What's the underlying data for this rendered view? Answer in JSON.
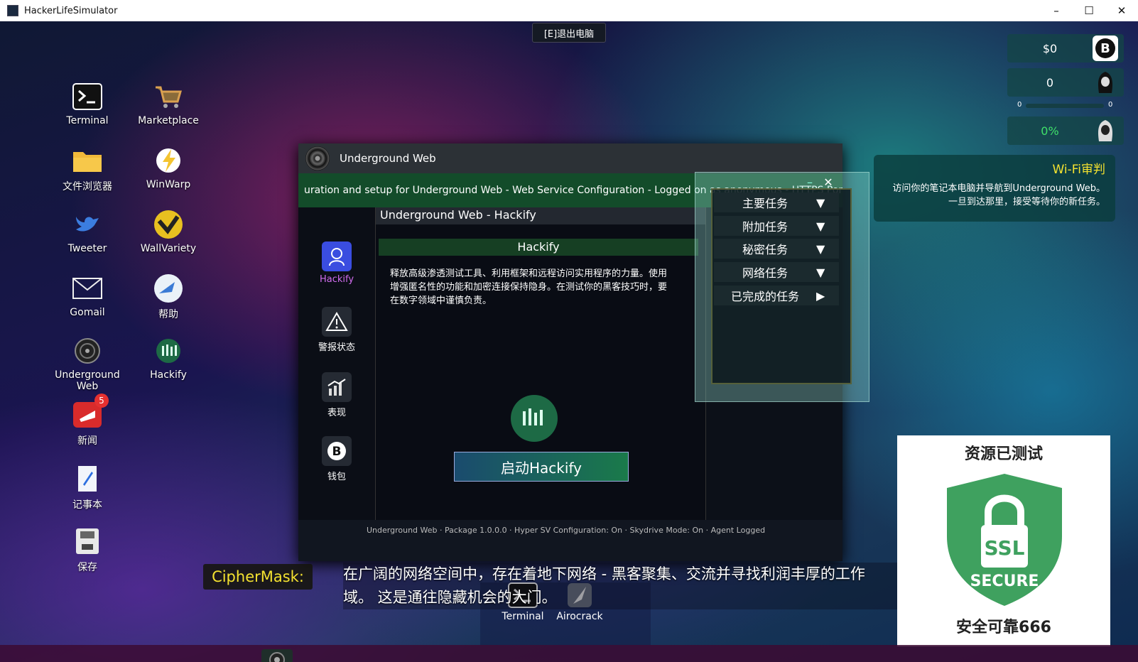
{
  "window": {
    "title": "HackerLifeSimulator",
    "controls": [
      "–",
      "☐",
      "✕"
    ]
  },
  "exit_button": "[E]退出电脑",
  "desktop_icons": [
    {
      "label": "Terminal"
    },
    {
      "label": "Marketplace"
    },
    {
      "label": "文件浏览器"
    },
    {
      "label": "WinWarp"
    },
    {
      "label": "Tweeter"
    },
    {
      "label": "WallVariety"
    },
    {
      "label": "Gomail"
    },
    {
      "label": "帮助"
    },
    {
      "label": "Underground Web"
    },
    {
      "label": "Hackify"
    },
    {
      "label": "新闻",
      "badge": "5"
    },
    {
      "label": "记事本"
    },
    {
      "label": "保存"
    }
  ],
  "stats": {
    "money": "$0",
    "rep": "0",
    "bar_left": "0",
    "bar_right": "0",
    "percent": "0%"
  },
  "wifi": {
    "title": "Wi-Fi审判",
    "line1": "访问你的笔记本电脑并导航到Underground Web。",
    "line2": "一旦到达那里，接受等待你的新任务。"
  },
  "app": {
    "title": "Underground Web",
    "ticker": "uration and setup for Underground Web - Web Service Configuration - Logged on as anonymous - HTTPS Port Nu",
    "sidebar": [
      "Hackify",
      "警报状态",
      "表现",
      "钱包"
    ],
    "panel_title": "Underground Web - Hackify",
    "heading": "Hackify",
    "description": "释放高级渗透测试工具、利用框架和远程访问实用程序的力量。使用增强匿名性的功能和加密连接保持隐身。在测试你的黑客技巧时，要在数字领域中谨慎负责。",
    "launch": "启动Hackify",
    "footer": "Underground Web · Package 1.0.0.0 · Hyper SV Configuration: On · Skydrive Mode: On · Agent Logged"
  },
  "missions": {
    "controls": [
      "–",
      "✕"
    ],
    "rows": [
      "主要任务",
      "附加任务",
      "秘密任务",
      "网络任务",
      "已完成的任务"
    ]
  },
  "dock": [
    "Terminal",
    "Airocrack"
  ],
  "subtitle": {
    "speaker": "CipherMask:",
    "line1": "在广阔的网络空间中，存在着地下网络 - 黑客聚集、交流并寻找利润丰厚的工作",
    "line2": "域。 这是通往隐藏机会的大门。"
  },
  "ssl": {
    "top": "资源已测试",
    "badge1": "SSL",
    "badge2": "SECURE",
    "bottom": "安全可靠666"
  },
  "colors": {
    "accent_green": "#163f23",
    "wifi_title": "#f4e230",
    "ssl_green": "#3fa15f"
  }
}
